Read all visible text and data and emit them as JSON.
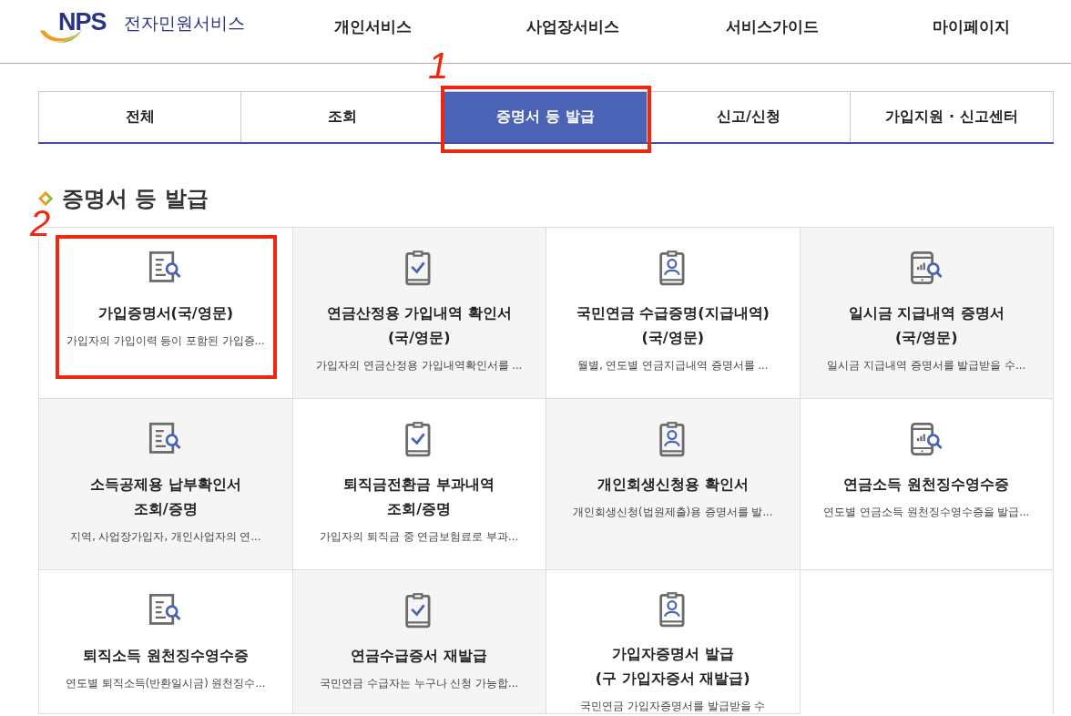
{
  "header": {
    "logo_text": "NPS",
    "service_name": "전자민원서비스",
    "nav": [
      {
        "label": "개인서비스"
      },
      {
        "label": "사업장서비스"
      },
      {
        "label": "서비스가이드"
      },
      {
        "label": "마이페이지"
      }
    ]
  },
  "tabs": [
    {
      "label": "전체",
      "selected": false
    },
    {
      "label": "조회",
      "selected": false
    },
    {
      "label": "증명서 등 발급",
      "selected": true,
      "annotation": "1"
    },
    {
      "label": "신고/신청",
      "selected": false
    },
    {
      "label": "가입지원 · 신고센터",
      "selected": false
    }
  ],
  "section_title": "증명서 등 발급",
  "cards": [
    {
      "kind": "document",
      "title": "가입증명서(국/영문)",
      "description": "가입자의 가입이력 등이 포함된 가입증...",
      "annotation": "2"
    },
    {
      "kind": "clipboard",
      "title": "연금산정용 가입내역 확인서\n(국/영문)",
      "description": "가입자의 연금산정용 가입내역확인서를 ..."
    },
    {
      "kind": "badge",
      "title": "국민연금 수급증명(지급내역)\n(국/영문)",
      "description": "월별, 연도별 연금지급내역 증명서를 ..."
    },
    {
      "kind": "phone",
      "title": "일시금 지급내역 증명서\n(국/영문)",
      "description": "일시금 지급내역 증명서를 발급받을 수..."
    },
    {
      "kind": "document",
      "title": "소득공제용 납부확인서\n조회/증명",
      "description": "지역, 사업장가입자, 개인사업자의 연..."
    },
    {
      "kind": "clipboard",
      "title": "퇴직금전환금 부과내역\n조회/증명",
      "description": "가입자의 퇴직금 중 연금보험료로 부과..."
    },
    {
      "kind": "badge",
      "title": "개인회생신청용 확인서",
      "description": "개인회생신청(법원제출)용 증명서를 발..."
    },
    {
      "kind": "phone",
      "title": "연금소득 원천징수영수증",
      "description": "연도별 연금소득 원천징수영수증을 발급..."
    },
    {
      "kind": "document",
      "title": "퇴직소득 원천징수영수증",
      "description": "연도별 퇴직소득(반환일시금) 원천징수..."
    },
    {
      "kind": "clipboard",
      "title": "연금수급증서 재발급",
      "description": "국민연금 수급자는 누구나 신청 가능합..."
    },
    {
      "kind": "badge",
      "title": "가입자증명서 발급\n(구 가입자증서 재발급)",
      "description": "국민연금 가입자증명서를 발급받을 수"
    }
  ]
}
